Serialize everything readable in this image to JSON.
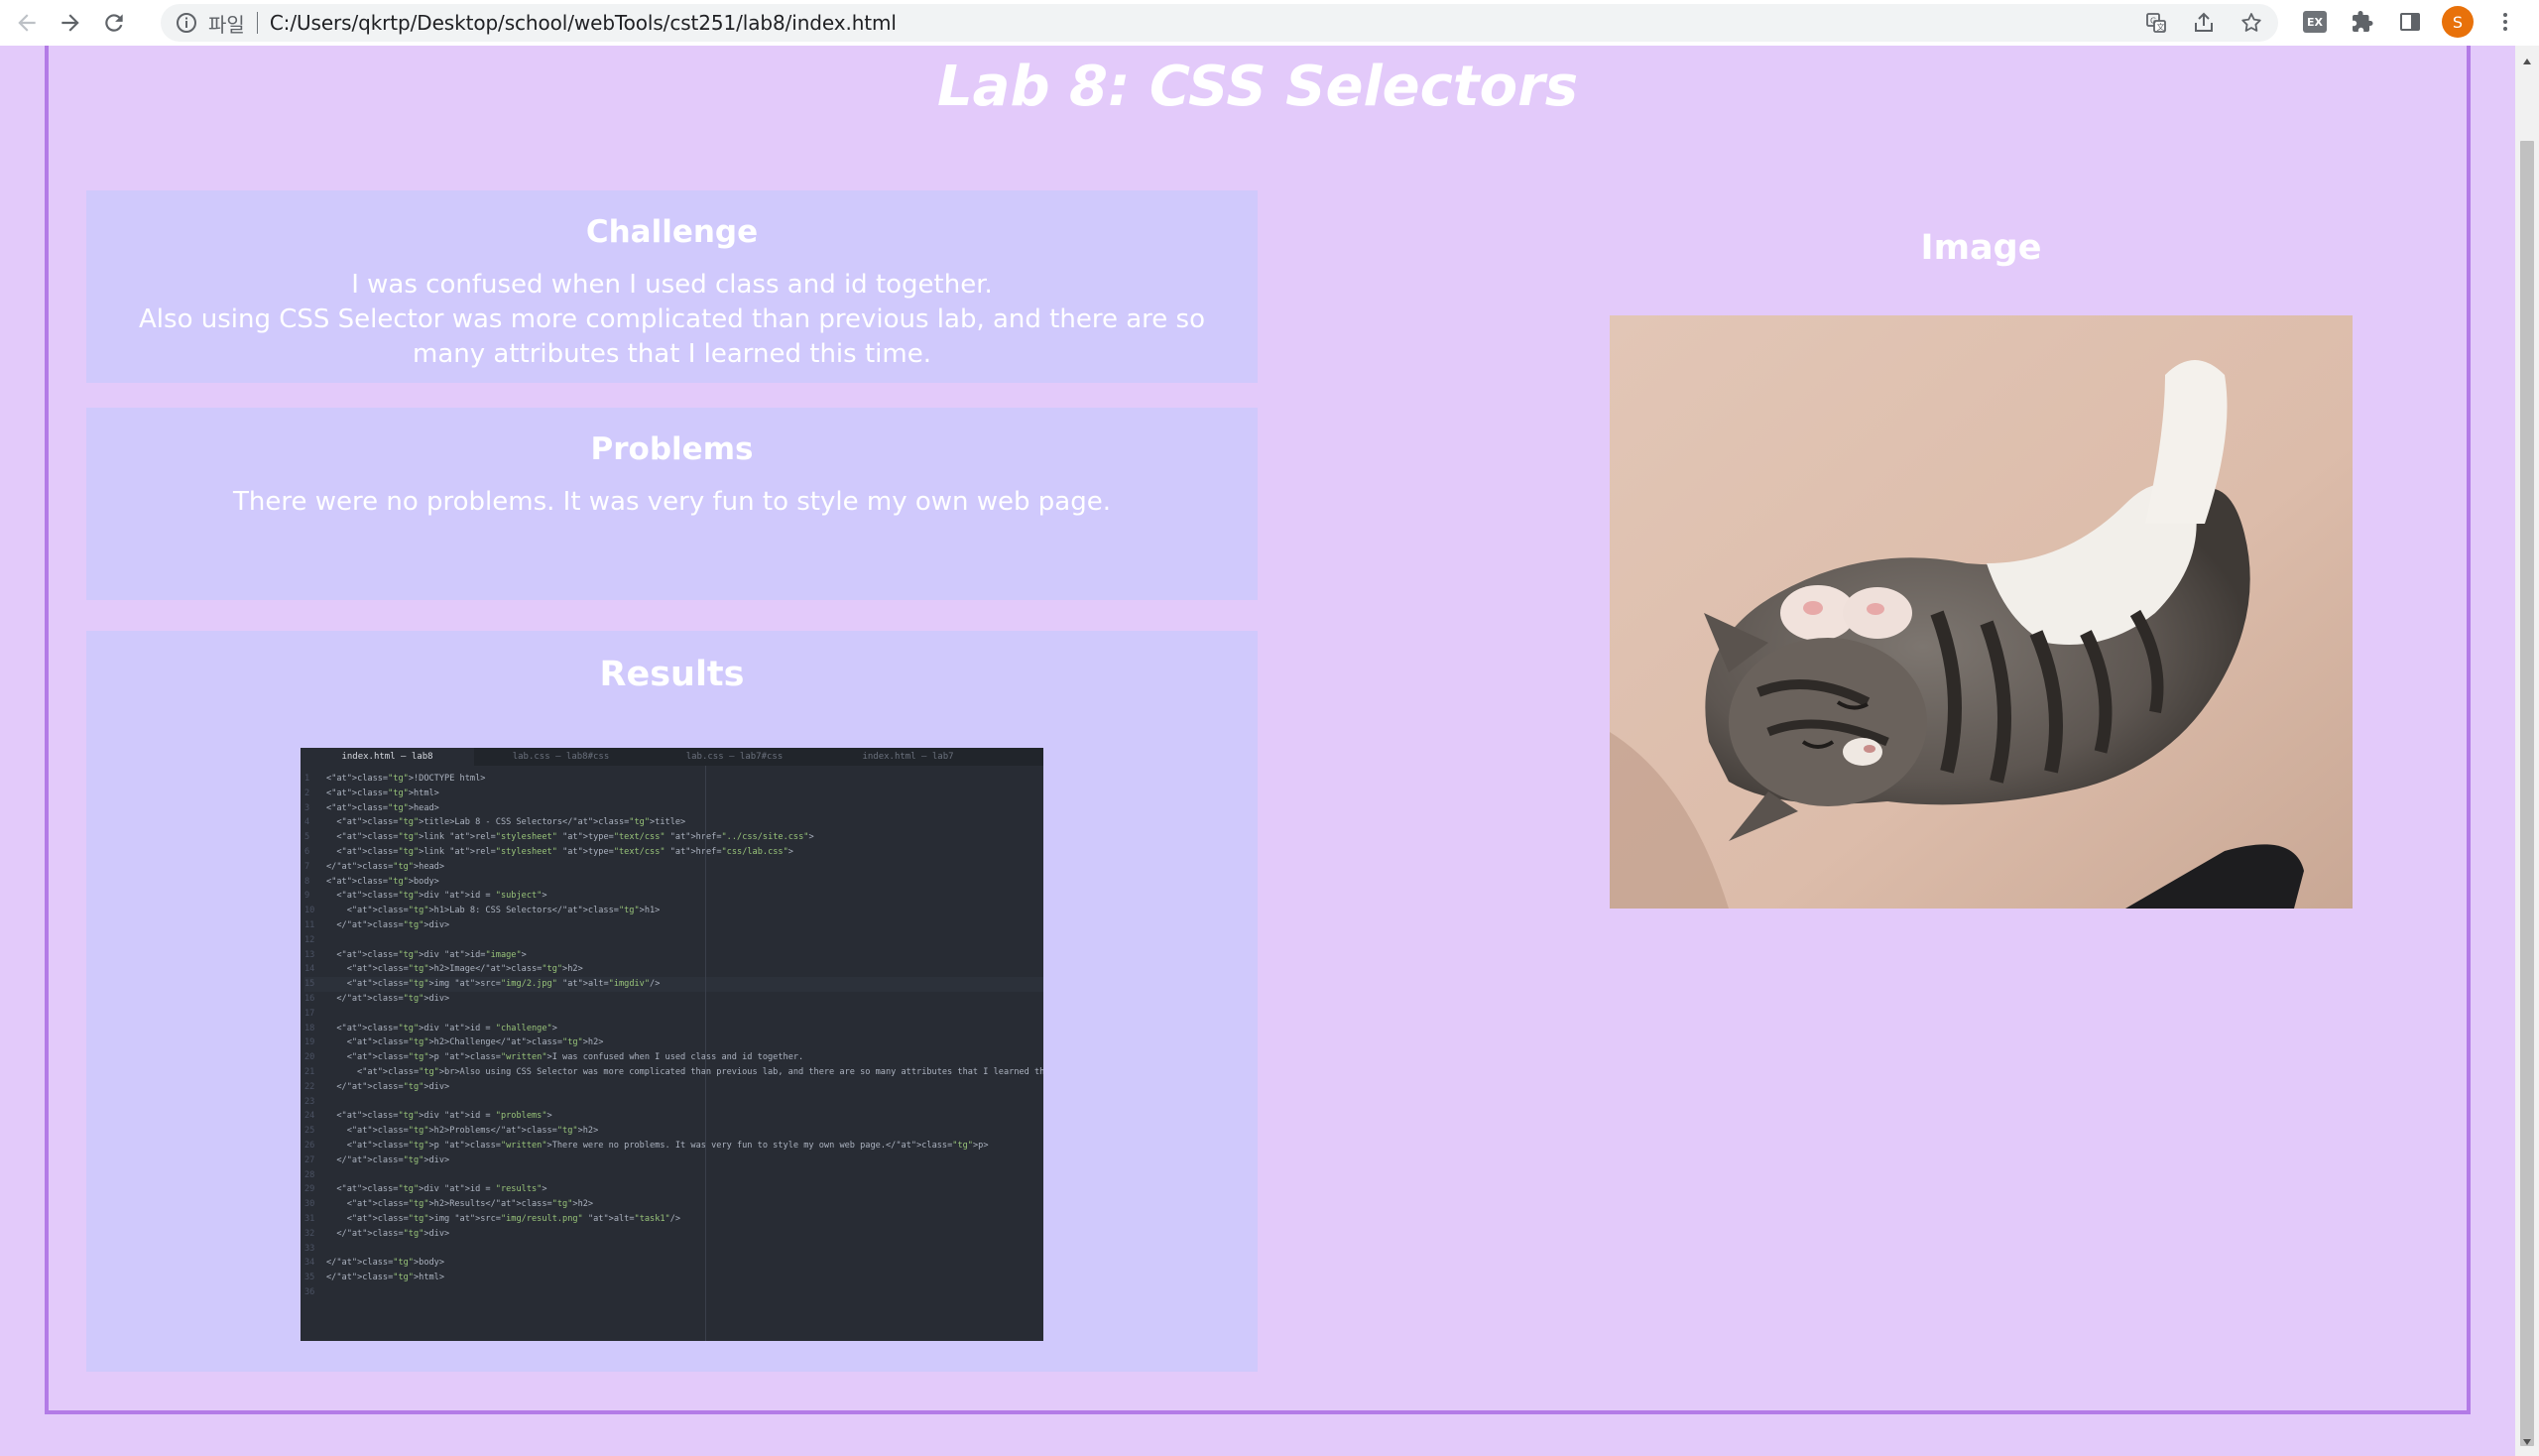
{
  "browser": {
    "site_chip": "파일",
    "url": "C:/Users/qkrtp/Desktop/school/webTools/cst251/lab8/index.html",
    "extension_badge": "EX",
    "profile_initial": "S"
  },
  "page": {
    "title": "Lab 8: CSS Selectors",
    "challenge": {
      "heading": "Challenge",
      "line1": "I was confused when I used class and id together.",
      "line2": "Also using CSS Selector was more complicated than previous lab, and there are so many attributes that I learned this time."
    },
    "problems": {
      "heading": "Problems",
      "text": "There were no problems. It was very fun to style my own web page."
    },
    "results": {
      "heading": "Results",
      "image_alt": "task1",
      "editor_tabs": [
        "index.html — lab8",
        "lab.css — lab8#css",
        "lab.css — lab7#css",
        "index.html — lab7"
      ],
      "code": [
        "<!DOCTYPE html>",
        "<html>",
        "<head>",
        "  <title>Lab 8 - CSS Selectors</title>",
        "  <link rel=\"stylesheet\" type=\"text/css\" href=\"../css/site.css\">",
        "  <link rel=\"stylesheet\" type=\"text/css\" href=\"css/lab.css\">",
        "</head>",
        "<body>",
        "  <div id = \"subject\">",
        "    <h1>Lab 8: CSS Selectors</h1>",
        "  </div>",
        "",
        "  <div id=\"image\">",
        "    <h2>Image</h2>",
        "    <img src=\"img/2.jpg\" alt=\"imgdiv\"/>",
        "  </div>",
        "",
        "  <div id = \"challenge\">",
        "    <h2>Challenge</h2>",
        "    <p class=\"written\">I was confused when I used class and id together.",
        "      <br>Also using CSS Selector was more complicated than previous lab, and there are so many attributes that I learned this time.</p>",
        "  </div>",
        "",
        "  <div id = \"problems\">",
        "    <h2>Problems</h2>",
        "    <p class=\"written\">There were no problems. It was very fun to style my own web page.</p>",
        "  </div>",
        "",
        "  <div id = \"results\">",
        "    <h2>Results</h2>",
        "    <img src=\"img/result.png\" alt=\"task1\"/>",
        "  </div>",
        "",
        "</body>",
        "</html>",
        ""
      ]
    },
    "image": {
      "heading": "Image",
      "alt": "imgdiv"
    }
  },
  "colors": {
    "page_bg": "#e3cafa",
    "panel_bg": "#d0c9fc",
    "frame_border": "#b37be6",
    "text": "#ffffff"
  }
}
